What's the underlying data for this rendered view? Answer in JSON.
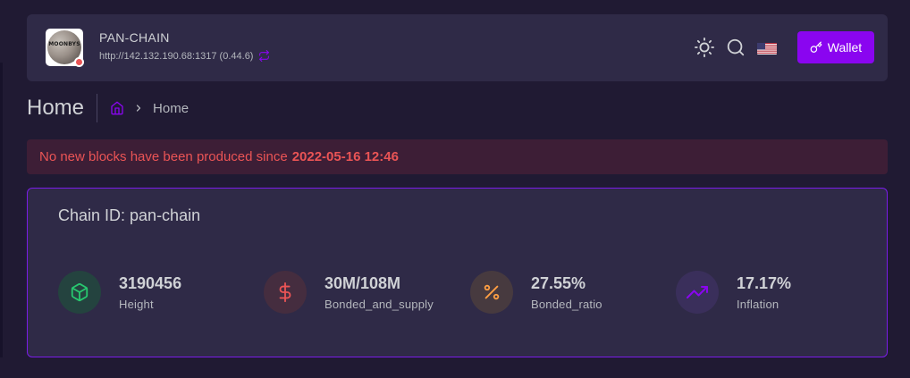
{
  "navbar": {
    "logo_text": "MOONBYS",
    "chain_name": "PAN-CHAIN",
    "endpoint": "http://142.132.190.68:1317 (0.44.6)",
    "wallet_label": "Wallet",
    "icons": [
      "sun-icon",
      "search-icon",
      "us-flag-icon",
      "key-icon",
      "sync-icon"
    ]
  },
  "page": {
    "title": "Home",
    "breadcrumb": [
      "home-icon",
      "Home"
    ]
  },
  "alert": {
    "message": "No new blocks have been produced since",
    "timestamp": "2022-05-16 12:46"
  },
  "card": {
    "title": "Chain ID: pan-chain",
    "stats": [
      {
        "value": "3190456",
        "label": "Height",
        "icon": "box-icon",
        "color": "#28c76f"
      },
      {
        "value": "30M/108M",
        "label": "Bonded_and_supply",
        "icon": "dollar-icon",
        "color": "#ea5455"
      },
      {
        "value": "27.55%",
        "label": "Bonded_ratio",
        "icon": "percent-icon",
        "color": "#ff9f43"
      },
      {
        "value": "17.17%",
        "label": "Inflation",
        "icon": "trending-up-icon",
        "color": "#8a05f0"
      }
    ]
  },
  "colors": {
    "background": "#201a33",
    "panel": "#2f2a47",
    "accent": "#8a05f0",
    "danger": "#ea5455"
  }
}
